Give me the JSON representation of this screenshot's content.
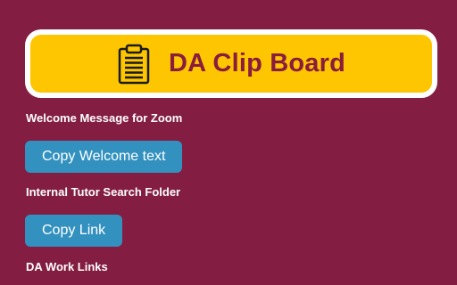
{
  "header": {
    "title": "DA Clip Board",
    "icon": "clipboard-icon",
    "background_color": "#fdc600",
    "title_color": "#8a1c3e"
  },
  "sections": [
    {
      "label": "Welcome Message for Zoom",
      "button_label": "Copy Welcome text"
    },
    {
      "label": "Internal Tutor Search Folder",
      "button_label": "Copy Link"
    },
    {
      "label": "DA Work Links"
    }
  ],
  "colors": {
    "page_background": "#831d41",
    "button_background": "#3391c0",
    "label_text": "#ffffff"
  }
}
